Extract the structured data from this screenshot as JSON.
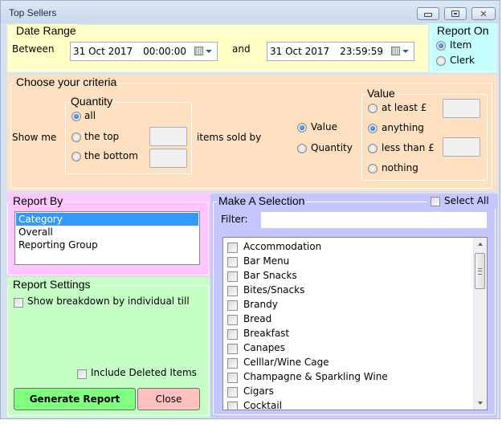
{
  "window": {
    "title": "Top Sellers",
    "buttons": {
      "minimize": "minimize",
      "maximize": "maximize",
      "close": "close"
    }
  },
  "date_range": {
    "legend": "Date Range",
    "between_label": "Between",
    "and_label": "and",
    "start": {
      "date": "31  Oct  2017",
      "time": "00:00:00"
    },
    "end": {
      "date": "31  Oct  2017",
      "time": "23:59:59"
    }
  },
  "report_on": {
    "legend": "Report On",
    "options": [
      {
        "label": "Item",
        "selected": true
      },
      {
        "label": "Clerk",
        "selected": false
      }
    ]
  },
  "criteria": {
    "legend": "Choose your criteria",
    "show_me_label": "Show me",
    "quantity": {
      "legend": "Quantity",
      "options": [
        {
          "label": "all",
          "selected": true
        },
        {
          "label": "the top",
          "selected": false,
          "value": ""
        },
        {
          "label": "the bottom",
          "selected": false,
          "value": ""
        }
      ]
    },
    "items_sold_by_label": "items sold by",
    "sold_by": [
      {
        "label": "Value",
        "selected": true
      },
      {
        "label": "Quantity",
        "selected": false
      }
    ],
    "value": {
      "legend": "Value",
      "options": [
        {
          "label": "at least £",
          "selected": false,
          "value": ""
        },
        {
          "label": "anything",
          "selected": true
        },
        {
          "label": "less than £",
          "selected": false,
          "value": ""
        },
        {
          "label": "nothing",
          "selected": false
        }
      ]
    }
  },
  "report_by": {
    "legend": "Report By",
    "options": [
      {
        "label": "Category",
        "selected": true
      },
      {
        "label": "Overall",
        "selected": false
      },
      {
        "label": "Reporting Group",
        "selected": false
      }
    ]
  },
  "report_settings": {
    "legend": "Report Settings",
    "show_breakdown_label": "Show breakdown by individual till",
    "show_breakdown_checked": false,
    "include_deleted_label": "Include Deleted Items",
    "include_deleted_checked": false,
    "generate_label": "Generate Report",
    "close_label": "Close",
    "colors": {
      "generate": "#80ff80",
      "close": "#ffc0c0"
    }
  },
  "selection": {
    "legend": "Make A Selection",
    "select_all_label": "Select All",
    "select_all_checked": false,
    "filter_label": "Filter:",
    "filter_value": "",
    "items": [
      {
        "label": "Accommodation",
        "checked": false
      },
      {
        "label": "Bar Menu",
        "checked": false
      },
      {
        "label": "Bar Snacks",
        "checked": false
      },
      {
        "label": "Bites/Snacks",
        "checked": false
      },
      {
        "label": "Brandy",
        "checked": false
      },
      {
        "label": "Bread",
        "checked": false
      },
      {
        "label": "Breakfast",
        "checked": false
      },
      {
        "label": "Canapes",
        "checked": false
      },
      {
        "label": "Celllar/Wine Cage",
        "checked": false
      },
      {
        "label": "Champagne & Sparkling Wine",
        "checked": false
      },
      {
        "label": "Cigars",
        "checked": false
      },
      {
        "label": "Cocktail",
        "checked": false
      }
    ]
  },
  "panel_colors": {
    "date_range": "#ffffc6",
    "report_on": "#c6ffff",
    "criteria": "#ffe0c0",
    "report_by": "#ffc6ff",
    "report_settings": "#c6ffc6",
    "selection": "#c6c6ff"
  }
}
